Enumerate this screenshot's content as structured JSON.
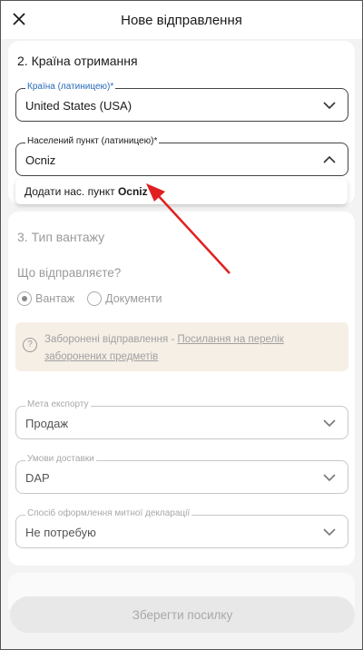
{
  "header": {
    "title": "Нове відправлення"
  },
  "section2": {
    "title": "2. Країна отримання",
    "country_label": "Країна (латиницею)*",
    "country_value": "United States (USA)",
    "city_label": "Населений пункт (латиницею)*",
    "city_value": "Ocniz",
    "dropdown_prefix": "Додати нас. пункт ",
    "dropdown_bold": "Ocniz"
  },
  "section3": {
    "title": "3. Тип вантажу",
    "question": "Що відправляєте?",
    "radio_cargo": "Вантаж",
    "radio_docs": "Документи",
    "notice_text": "Заборонені відправлення - ",
    "notice_link": "Посилання на перелік заборонених предметів",
    "export_label": "Мета експорту",
    "export_value": "Продаж",
    "delivery_label": "Умови доставки",
    "delivery_value": "DAP",
    "customs_label": "Спосіб оформлення митної декларації",
    "customs_value": "Не потребую"
  },
  "footer": {
    "save_label": "Зберегти посилку"
  },
  "colors": {
    "accent": "#2a6ab8",
    "arrow": "#e02020"
  }
}
